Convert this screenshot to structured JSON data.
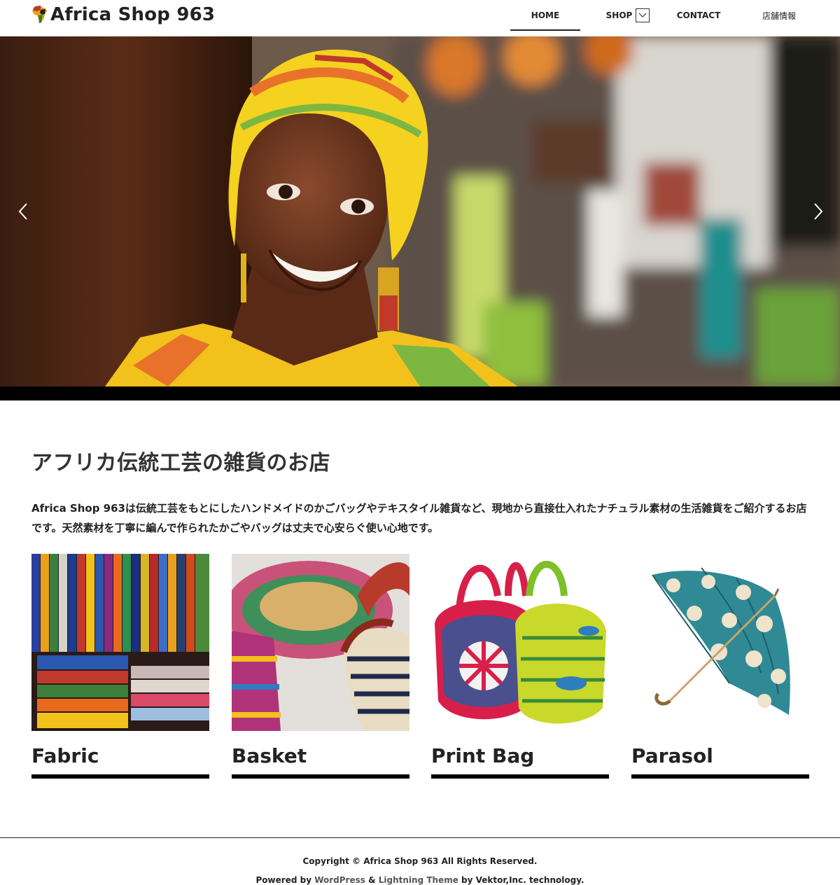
{
  "header": {
    "logo_text": "Africa Shop 963",
    "nav": {
      "home": "HOME",
      "shop": "SHOP",
      "contact": "CONTACT",
      "info": "店舗情報"
    }
  },
  "slider": {
    "prev_icon": "chevron-left-icon",
    "next_icon": "chevron-right-icon"
  },
  "main": {
    "heading": "アフリカ伝統工芸の雑貨のお店",
    "intro": "Africa Shop 963は伝統工芸をもとにしたハンドメイドのかごバッグやテキスタイル雑貨など、現地から直接仕入れたナチュラル素材の生活雑貨をご紹介するお店です。天然素材を丁寧に編んで作られたかごやバッグは丈夫で心安らぐ使い心地です。",
    "cards": [
      {
        "title": "Fabric"
      },
      {
        "title": "Basket"
      },
      {
        "title": "Print Bag"
      },
      {
        "title": "Parasol"
      }
    ]
  },
  "footer": {
    "copyright": "Copyright © Africa Shop 963 All Rights Reserved.",
    "powered_prefix": "Powered by",
    "wordpress": "WordPress",
    "amp": "&",
    "theme": "Lightning Theme",
    "by": "by Vektor,Inc. technology."
  },
  "colors": {
    "text": "#222222",
    "footer_link": "#555555",
    "accent_bar": "#000000"
  }
}
